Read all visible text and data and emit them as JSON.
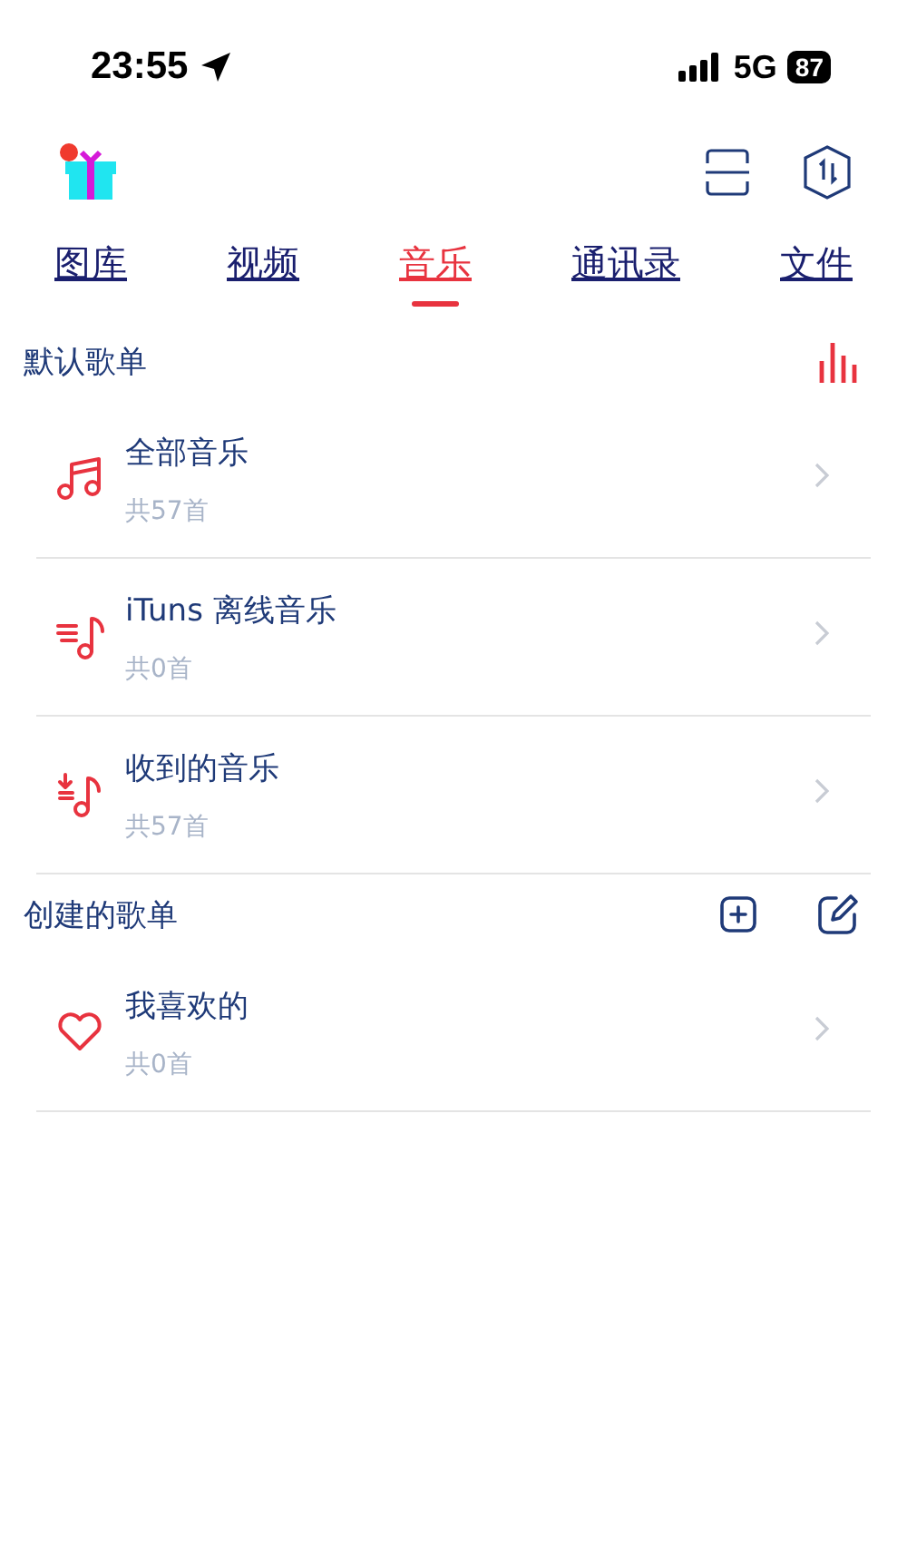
{
  "status_bar": {
    "time": "23:55",
    "network": "5G",
    "battery": "87"
  },
  "tabs": [
    {
      "label": "图库",
      "selected": false
    },
    {
      "label": "视频",
      "selected": false
    },
    {
      "label": "音乐",
      "selected": true
    },
    {
      "label": "通讯录",
      "selected": false
    },
    {
      "label": "文件",
      "selected": false
    }
  ],
  "sections": [
    {
      "title": "默认歌单",
      "actions": [
        {
          "kind": "equalizer"
        }
      ],
      "items": [
        {
          "kind": "notes",
          "title": "全部音乐",
          "count": "共57首"
        },
        {
          "kind": "list",
          "title": "iTuns 离线音乐",
          "count": "共0首"
        },
        {
          "kind": "received",
          "title": "收到的音乐",
          "count": "共57首"
        }
      ]
    },
    {
      "title": "创建的歌单",
      "actions": [
        {
          "kind": "add"
        },
        {
          "kind": "edit"
        }
      ],
      "items": [
        {
          "kind": "heart",
          "title": "我喜欢的",
          "count": "共0首"
        }
      ]
    }
  ]
}
